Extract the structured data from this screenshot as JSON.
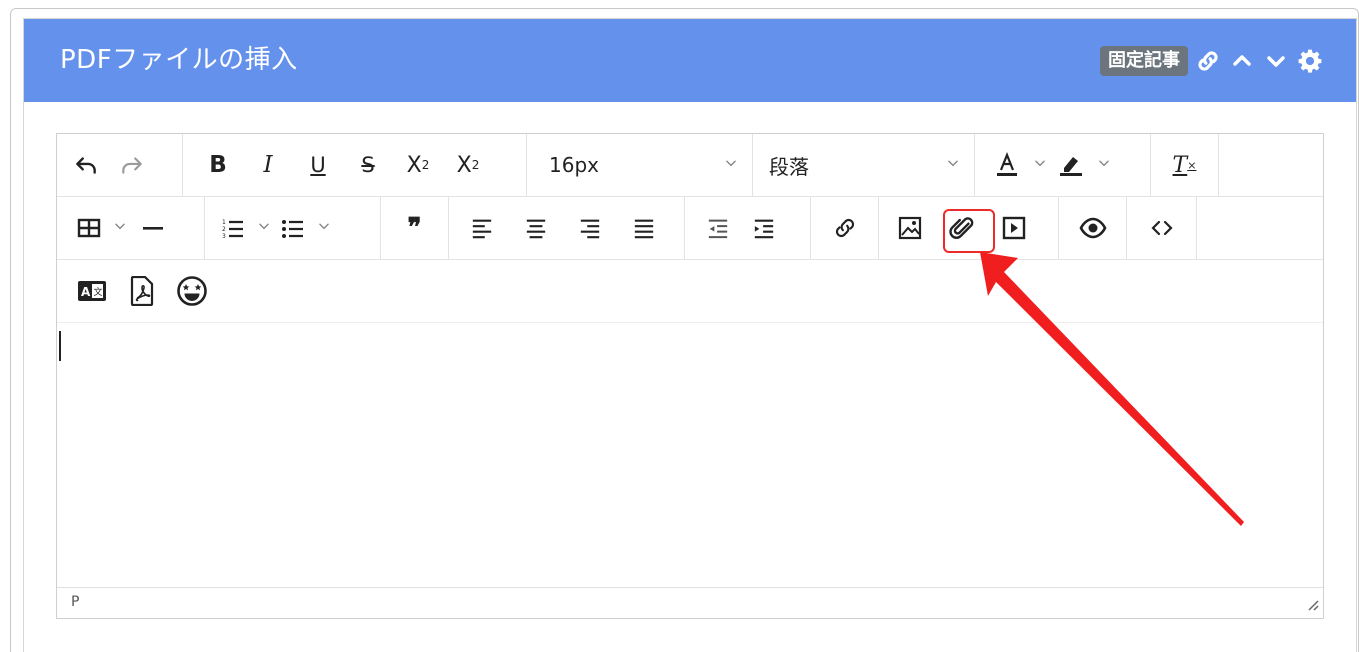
{
  "panel": {
    "title": "PDFファイルの挿入",
    "badge": "固定記事"
  },
  "toolbar": {
    "font_size": "16px",
    "block_format": "段落"
  },
  "status": {
    "path": "P"
  },
  "icons": {
    "header": [
      "link-icon",
      "chevron-up-icon",
      "chevron-down-icon",
      "gear-icon"
    ],
    "highlighted": "attachment-icon"
  },
  "colors": {
    "header_bg": "#6491ec",
    "badge_bg": "#6c757d",
    "highlight": "#ee2b2b"
  }
}
